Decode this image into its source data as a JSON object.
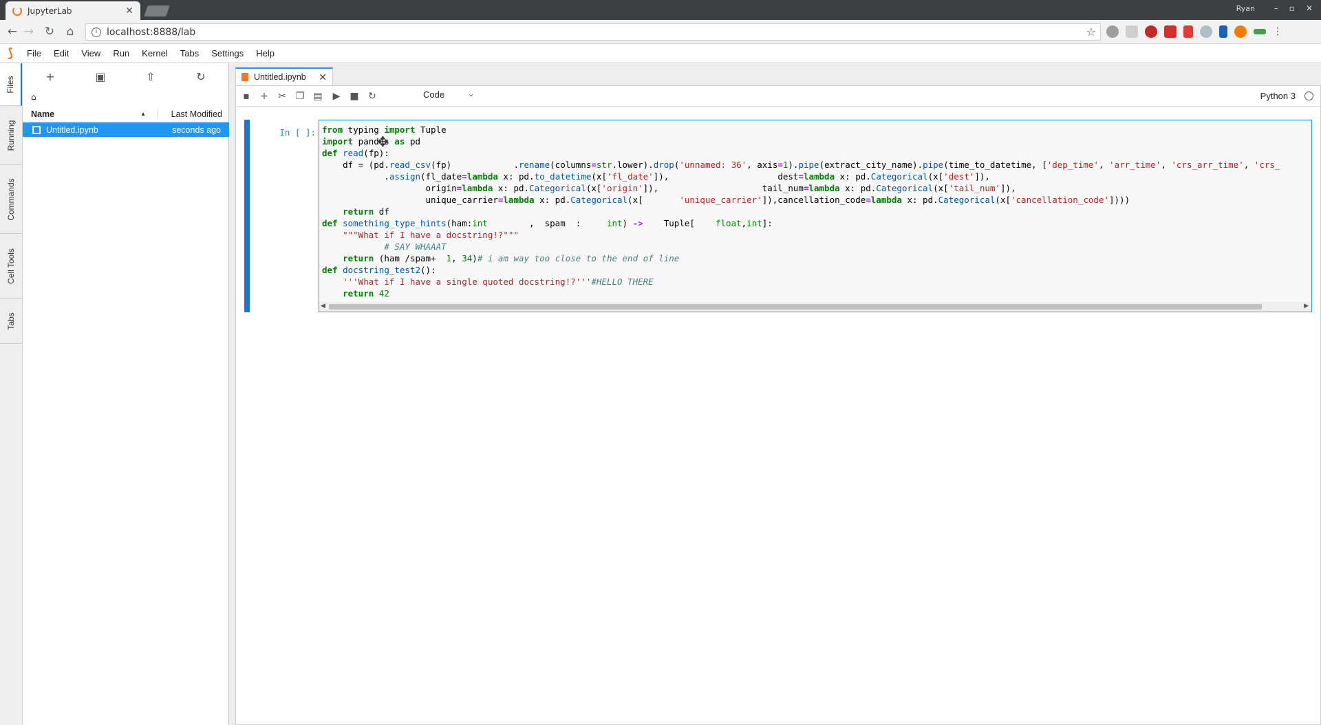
{
  "browser": {
    "tab_title": "JupyterLab",
    "url": "localhost:8888/lab",
    "user": "Ryan",
    "tab_close": "✕"
  },
  "menu": {
    "items": [
      "File",
      "Edit",
      "View",
      "Run",
      "Kernel",
      "Tabs",
      "Settings",
      "Help"
    ]
  },
  "sidebar": {
    "tabs": [
      "Files",
      "Running",
      "Commands",
      "Cell Tools",
      "Tabs"
    ]
  },
  "filebrowser": {
    "col_name": "Name",
    "col_modified": "Last Modified",
    "sort_glyph": "▲",
    "home_glyph": "⌂",
    "files": [
      {
        "name": "Untitled.ipynb",
        "modified": "seconds ago"
      }
    ]
  },
  "notebook": {
    "tab_label": "Untitled.ipynb",
    "cell_type": "Code",
    "kernel": "Python 3",
    "prompt": "In [ ]:",
    "code_lines": [
      "from typing import Tuple",
      "import pandas as pd",
      "def read(fp):",
      "    df = (pd.read_csv(fp)            .rename(columns=str.lower).drop('unnamed: 36', axis=1).pipe(extract_city_name).pipe(time_to_datetime, ['dep_time', 'arr_time', 'crs_arr_time', 'crs_",
      "            .assign(fl_date=lambda x: pd.to_datetime(x['fl_date']),                     dest=lambda x: pd.Categorical(x['dest']),",
      "                    origin=lambda x: pd.Categorical(x['origin']),                    tail_num=lambda x: pd.Categorical(x['tail_num']),",
      "                    unique_carrier=lambda x: pd.Categorical(x[       'unique_carrier']),cancellation_code=lambda x: pd.Categorical(x['cancellation_code'])))",
      "    return df",
      "def something_type_hints(ham:int        ,  spam  :     int) ->    Tuple[    float,int]:",
      "    \"\"\"What if I have a docstring!?\"\"\"",
      "            # SAY WHAAAT",
      "    return (ham /spam+  1, 34)# i am way too close to the end of line",
      "def docstring_test2():",
      "    '''What if I have a single quoted docstring!?'''#HELLO THERE",
      "    return 42"
    ]
  },
  "colors": {
    "accent": "#2196f3",
    "jupyter_orange": "#f37726",
    "keyword": "#008000",
    "string": "#ba2121",
    "comment": "#408080",
    "prompt": "#307fc1"
  }
}
